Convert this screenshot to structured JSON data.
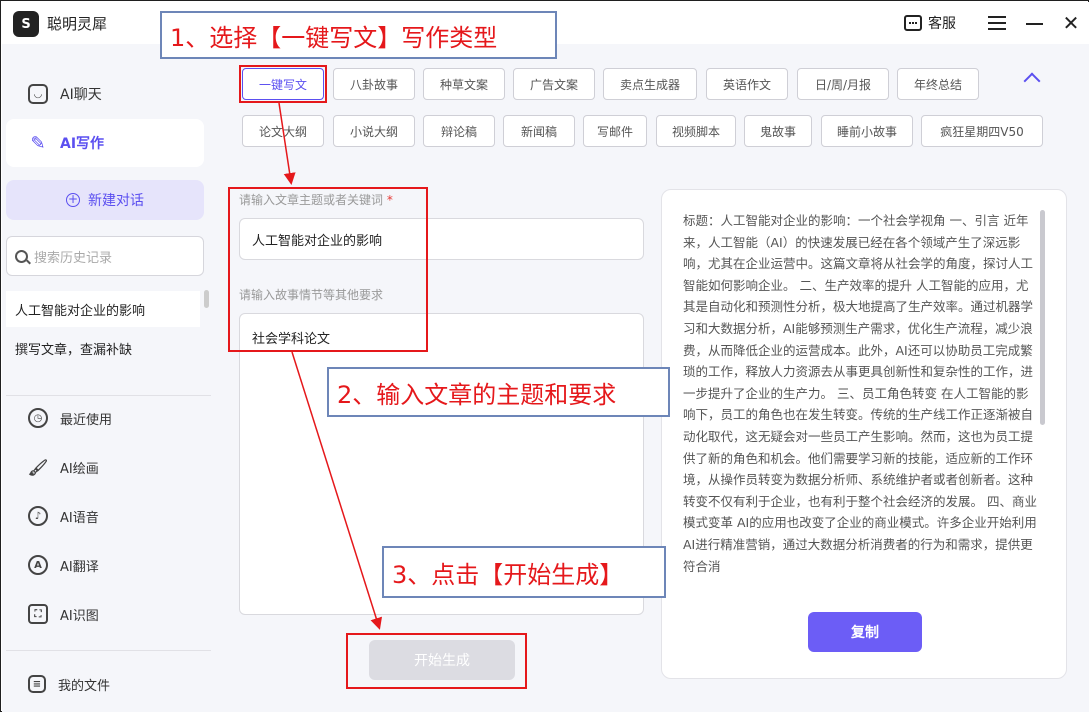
{
  "app": {
    "title": "聪明灵犀",
    "logo_glyph": "S"
  },
  "titlebar": {
    "support_label": "客服"
  },
  "sidebar": {
    "nav": [
      {
        "label": "AI聊天",
        "icon": "chat-icon"
      },
      {
        "label": "AI写作",
        "icon": "pen-icon"
      }
    ],
    "new_chat_label": "新建对话",
    "search_placeholder": "搜索历史记录",
    "history": [
      "人工智能对企业的影响",
      "撰写文章，查漏补缺"
    ],
    "tools": [
      {
        "label": "最近使用",
        "icon": "clock-icon"
      },
      {
        "label": "AI绘画",
        "icon": "brush-icon"
      },
      {
        "label": "AI语音",
        "icon": "voice-icon"
      },
      {
        "label": "AI翻译",
        "icon": "translate-icon"
      },
      {
        "label": "AI识图",
        "icon": "image-scan-icon"
      }
    ],
    "my_files_label": "我的文件"
  },
  "types": {
    "row1": [
      "一键写文",
      "八卦故事",
      "种草文案",
      "广告文案",
      "卖点生成器",
      "英语作文",
      "日/周/月报",
      "年终总结"
    ],
    "row2": [
      "论文大纲",
      "小说大纲",
      "辩论稿",
      "新闻稿",
      "写邮件",
      "视频脚本",
      "鬼故事",
      "睡前小故事",
      "疯狂星期四V50"
    ],
    "selected": "一键写文"
  },
  "form": {
    "topic_label": "请输入文章主题或者关键词",
    "topic_required_mark": "*",
    "topic_value": "人工智能对企业的影响",
    "requirements_label": "请输入故事情节等其他要求",
    "requirements_value": "社会学科论文",
    "generate_label": "开始生成"
  },
  "result": {
    "text": "标题：人工智能对企业的影响：一个社会学视角 一、引言 近年来，人工智能（AI）的快速发展已经在各个领域产生了深远影响，尤其在企业运营中。这篇文章将从社会学的角度，探讨人工智能如何影响企业。 二、生产效率的提升 人工智能的应用，尤其是自动化和预测性分析，极大地提高了生产效率。通过机器学习和大数据分析，AI能够预测生产需求，优化生产流程，减少浪费，从而降低企业的运营成本。此外，AI还可以协助员工完成繁琐的工作，释放人力资源去从事更具创新性和复杂性的工作，进一步提升了企业的生产力。 三、员工角色转变 在人工智能的影响下，员工的角色也在发生转变。传统的生产线工作正逐渐被自动化取代，这无疑会对一些员工产生影响。然而，这也为员工提供了新的角色和机会。他们需要学习新的技能，适应新的工作环境，从操作员转变为数据分析师、系统维护者或者创新者。这种转变不仅有利于企业，也有利于整个社会经济的发展。 四、商业模式变革 AI的应用也改变了企业的商业模式。许多企业开始利用AI进行精准营销，通过大数据分析消费者的行为和需求，提供更符合消",
    "copy_label": "复制"
  },
  "annotations": {
    "step1": "1、选择【一键写文】写作类型",
    "step2": "2、输入文章的主题和要求",
    "step3": "3、点击【开始生成】"
  },
  "colors": {
    "accent": "#5b4ff0",
    "annotation_red": "#e5181b",
    "callout_border": "#6d86b8"
  }
}
